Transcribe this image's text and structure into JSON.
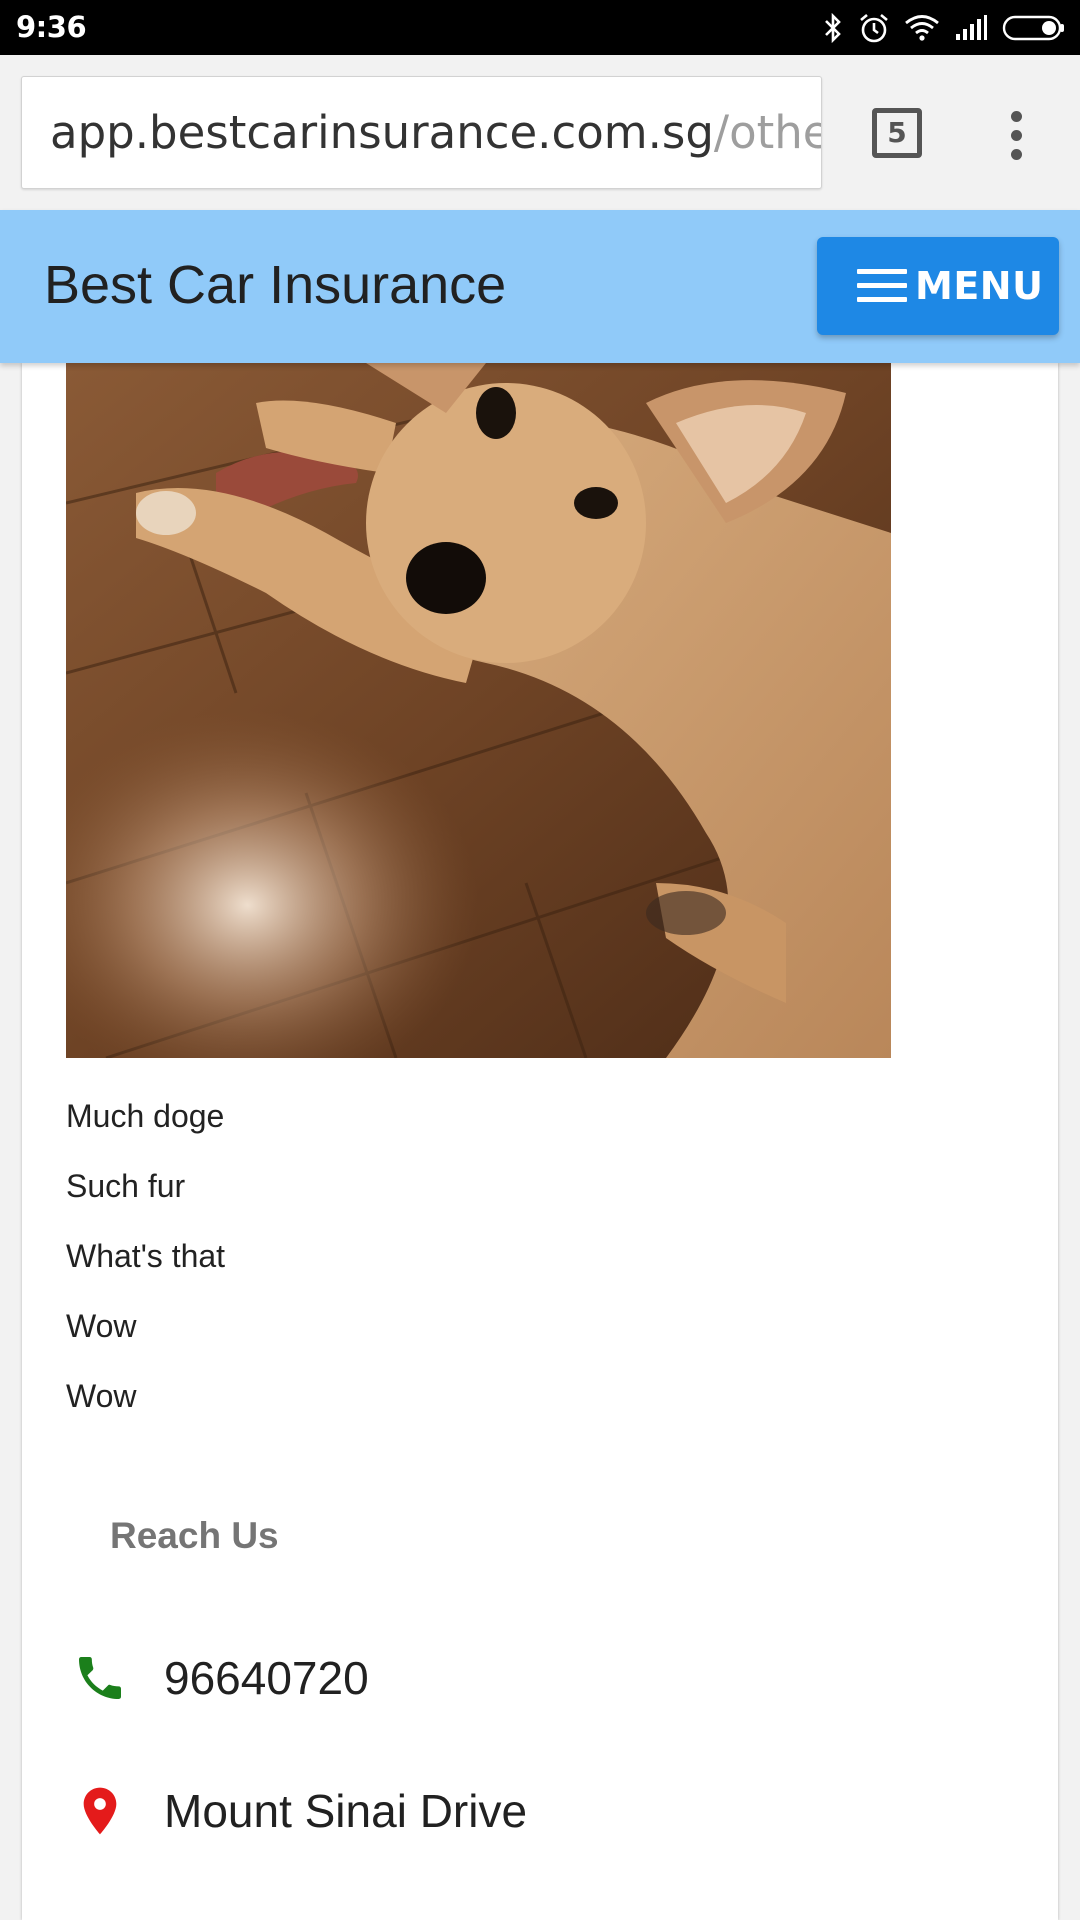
{
  "status_bar": {
    "time": "9:36",
    "icons": [
      "bluetooth-icon",
      "alarm-icon",
      "wifi-icon",
      "signal-icon",
      "battery-icon"
    ]
  },
  "browser": {
    "url_host": "app.bestcarinsurance.com.sg",
    "url_path": "/othe",
    "tab_count": "5",
    "overflow_icon": "overflow-menu-icon"
  },
  "header": {
    "title": "Best Car Insurance",
    "menu_label": "MENU",
    "menu_icon": "hamburger-icon",
    "background_color": "#90caf9",
    "button_color": "#1e88e5"
  },
  "main": {
    "image_subject": "dog",
    "captions": [
      "Much doge",
      "Such fur",
      "What's that",
      "Wow",
      "Wow"
    ]
  },
  "reach_us": {
    "heading": "Reach Us",
    "phone": "96640720",
    "phone_icon": "phone-icon",
    "phone_icon_color": "#1b7f1b",
    "address": "Mount Sinai Drive",
    "address_icon": "location-pin-icon",
    "address_icon_color": "#e41b1b"
  }
}
